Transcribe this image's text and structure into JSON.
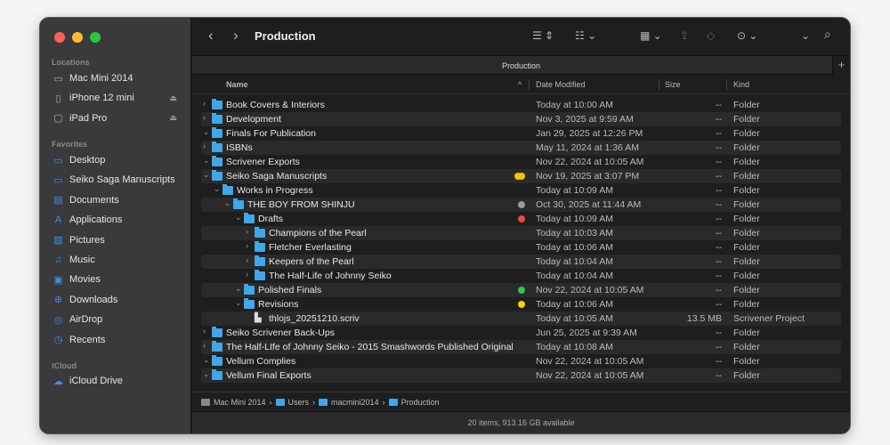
{
  "window": {
    "title": "Production",
    "tab": "Production",
    "status": "20 items, 913.16 GB available"
  },
  "colors": {
    "close": "#ff5f57",
    "minimize": "#febc2e",
    "zoom": "#28c840",
    "folder": "#3fa7ea",
    "accent": "#3b8ff0"
  },
  "sidebar": {
    "locations_label": "Locations",
    "locations": [
      {
        "label": "Mac Mini 2014",
        "icon": "computer-icon"
      },
      {
        "label": "iPhone 12 mini",
        "icon": "phone-icon",
        "eject": true
      },
      {
        "label": "iPad Pro",
        "icon": "tablet-icon",
        "eject": true
      }
    ],
    "favorites_label": "Favorites",
    "favorites": [
      {
        "label": "Desktop",
        "icon": "desktop-icon"
      },
      {
        "label": "Seiko Saga Manuscripts",
        "icon": "folder-icon"
      },
      {
        "label": "Documents",
        "icon": "document-icon"
      },
      {
        "label": "Applications",
        "icon": "applications-icon"
      },
      {
        "label": "Pictures",
        "icon": "pictures-icon"
      },
      {
        "label": "Music",
        "icon": "music-icon"
      },
      {
        "label": "Movies",
        "icon": "movies-icon"
      },
      {
        "label": "Downloads",
        "icon": "downloads-icon"
      },
      {
        "label": "AirDrop",
        "icon": "airdrop-icon"
      },
      {
        "label": "Recents",
        "icon": "recents-icon"
      }
    ],
    "icloud_label": "iCloud",
    "icloud": [
      {
        "label": "iCloud Drive",
        "icon": "cloud-icon"
      }
    ]
  },
  "columns": {
    "name": "Name",
    "date": "Date Modified",
    "size": "Size",
    "kind": "Kind"
  },
  "rows": [
    {
      "name": "Book Covers & Interiors",
      "level": 0,
      "disclosure": "right",
      "date": "Today at 10:00 AM",
      "size": "--",
      "kind": "Folder"
    },
    {
      "name": "Development",
      "level": 0,
      "disclosure": "right",
      "date": "Nov 3, 2025 at 9:59 AM",
      "size": "--",
      "kind": "Folder"
    },
    {
      "name": "Finals For Publication",
      "level": 0,
      "disclosure": "down",
      "date": "Jan 29, 2025 at 12:26 PM",
      "size": "--",
      "kind": "Folder"
    },
    {
      "name": "ISBNs",
      "level": 0,
      "disclosure": "right",
      "date": "May 11, 2024 at 1:36 AM",
      "size": "--",
      "kind": "Folder"
    },
    {
      "name": "Scrivener Exports",
      "level": 0,
      "disclosure": "down",
      "date": "Nov 22, 2024 at 10:05 AM",
      "size": "--",
      "kind": "Folder"
    },
    {
      "name": "Seiko Saga Manuscripts",
      "level": 0,
      "disclosure": "down",
      "tags": [
        "#f5c400",
        "#f5c400"
      ],
      "date": "Nov 19, 2025 at 3:07 PM",
      "size": "--",
      "kind": "Folder"
    },
    {
      "name": "Works in Progress",
      "level": 1,
      "disclosure": "down",
      "date": "Today at 10:09 AM",
      "size": "--",
      "kind": "Folder"
    },
    {
      "name": "THE BOY FROM SHINJU",
      "level": 2,
      "disclosure": "down",
      "tags": [
        "#9a9a9a"
      ],
      "date": "Oct 30, 2025 at 11:44 AM",
      "size": "--",
      "kind": "Folder"
    },
    {
      "name": "Drafts",
      "level": 3,
      "disclosure": "down",
      "tags": [
        "#f0463c"
      ],
      "date": "Today at 10:09 AM",
      "size": "--",
      "kind": "Folder"
    },
    {
      "name": "Champions of the Pearl",
      "level": 4,
      "disclosure": "right",
      "date": "Today at 10:03 AM",
      "size": "--",
      "kind": "Folder"
    },
    {
      "name": "Fletcher Everlasting",
      "level": 4,
      "disclosure": "right",
      "date": "Today at 10:06 AM",
      "size": "--",
      "kind": "Folder"
    },
    {
      "name": "Keepers of the Pearl",
      "level": 4,
      "disclosure": "right",
      "date": "Today at 10:04 AM",
      "size": "--",
      "kind": "Folder"
    },
    {
      "name": "The Half-Life of Johnny Seiko",
      "level": 4,
      "disclosure": "right",
      "date": "Today at 10:04 AM",
      "size": "--",
      "kind": "Folder"
    },
    {
      "name": "Polished Finals",
      "level": 3,
      "disclosure": "down",
      "tags": [
        "#32c84a"
      ],
      "date": "Nov 22, 2024 at 10:05 AM",
      "size": "--",
      "kind": "Folder"
    },
    {
      "name": "Revisions",
      "level": 3,
      "disclosure": "down",
      "tags": [
        "#f5d400"
      ],
      "date": "Today at 10:06 AM",
      "size": "--",
      "kind": "Folder"
    },
    {
      "name": "thlojs_20251210.scriv",
      "level": 4,
      "disclosure": "none",
      "file": true,
      "date": "Today at 10:05 AM",
      "size": "13.5 MB",
      "kind": "Scrivener Project"
    },
    {
      "name": "Seiko Scrivener Back-Ups",
      "level": 0,
      "disclosure": "right",
      "date": "Jun 25, 2025 at 9:39 AM",
      "size": "--",
      "kind": "Folder"
    },
    {
      "name": "The Half-LIfe of Johnny Seiko - 2015 Smashwords Published Original",
      "level": 0,
      "disclosure": "right",
      "date": "Today at 10:08 AM",
      "size": "--",
      "kind": "Folder"
    },
    {
      "name": "Vellum Complies",
      "level": 0,
      "disclosure": "down",
      "date": "Nov 22, 2024 at 10:05 AM",
      "size": "--",
      "kind": "Folder"
    },
    {
      "name": "Vellum Final Exports",
      "level": 0,
      "disclosure": "down",
      "date": "Nov 22, 2024 at 10:05 AM",
      "size": "--",
      "kind": "Folder"
    }
  ],
  "path": [
    "Mac Mini 2014",
    "Users",
    "macmini2014",
    "Production"
  ]
}
